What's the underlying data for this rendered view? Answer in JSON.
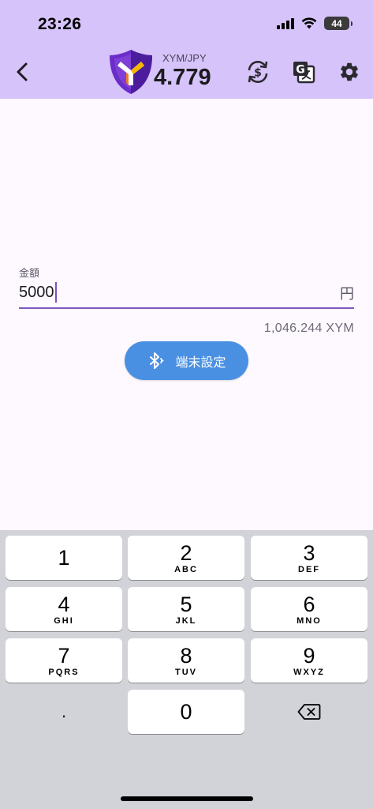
{
  "status_bar": {
    "time": "23:26",
    "battery": "44",
    "icons": [
      "signal-icon",
      "wifi-icon",
      "battery-icon"
    ]
  },
  "app_bar": {
    "back_icon": "chevron-left-icon",
    "logo": "symbol-logo",
    "pair": "XYM/JPY",
    "rate": "4.779",
    "actions": [
      "currency-exchange-icon",
      "translate-icon",
      "gear-icon"
    ],
    "colors": {
      "background": "#d6c3fa",
      "logo_purple": "#6a2dc9",
      "logo_gold": "#f5b700"
    }
  },
  "form": {
    "label": "金額",
    "value": "5000",
    "suffix": "円",
    "converted": "1,046.244 XYM",
    "accent": "#7e57c2"
  },
  "device_button": {
    "label": "端末設定",
    "icon": "bluetooth-icon",
    "color": "#4a90e2"
  },
  "keypad": {
    "keys": [
      {
        "digit": "1",
        "letters": ""
      },
      {
        "digit": "2",
        "letters": "ABC"
      },
      {
        "digit": "3",
        "letters": "DEF"
      },
      {
        "digit": "4",
        "letters": "GHI"
      },
      {
        "digit": "5",
        "letters": "JKL"
      },
      {
        "digit": "6",
        "letters": "MNO"
      },
      {
        "digit": "7",
        "letters": "PQRS"
      },
      {
        "digit": "8",
        "letters": "TUV"
      },
      {
        "digit": "9",
        "letters": "WXYZ"
      },
      {
        "digit": "0",
        "letters": ""
      }
    ],
    "decimal": ".",
    "delete_icon": "backspace-icon"
  }
}
